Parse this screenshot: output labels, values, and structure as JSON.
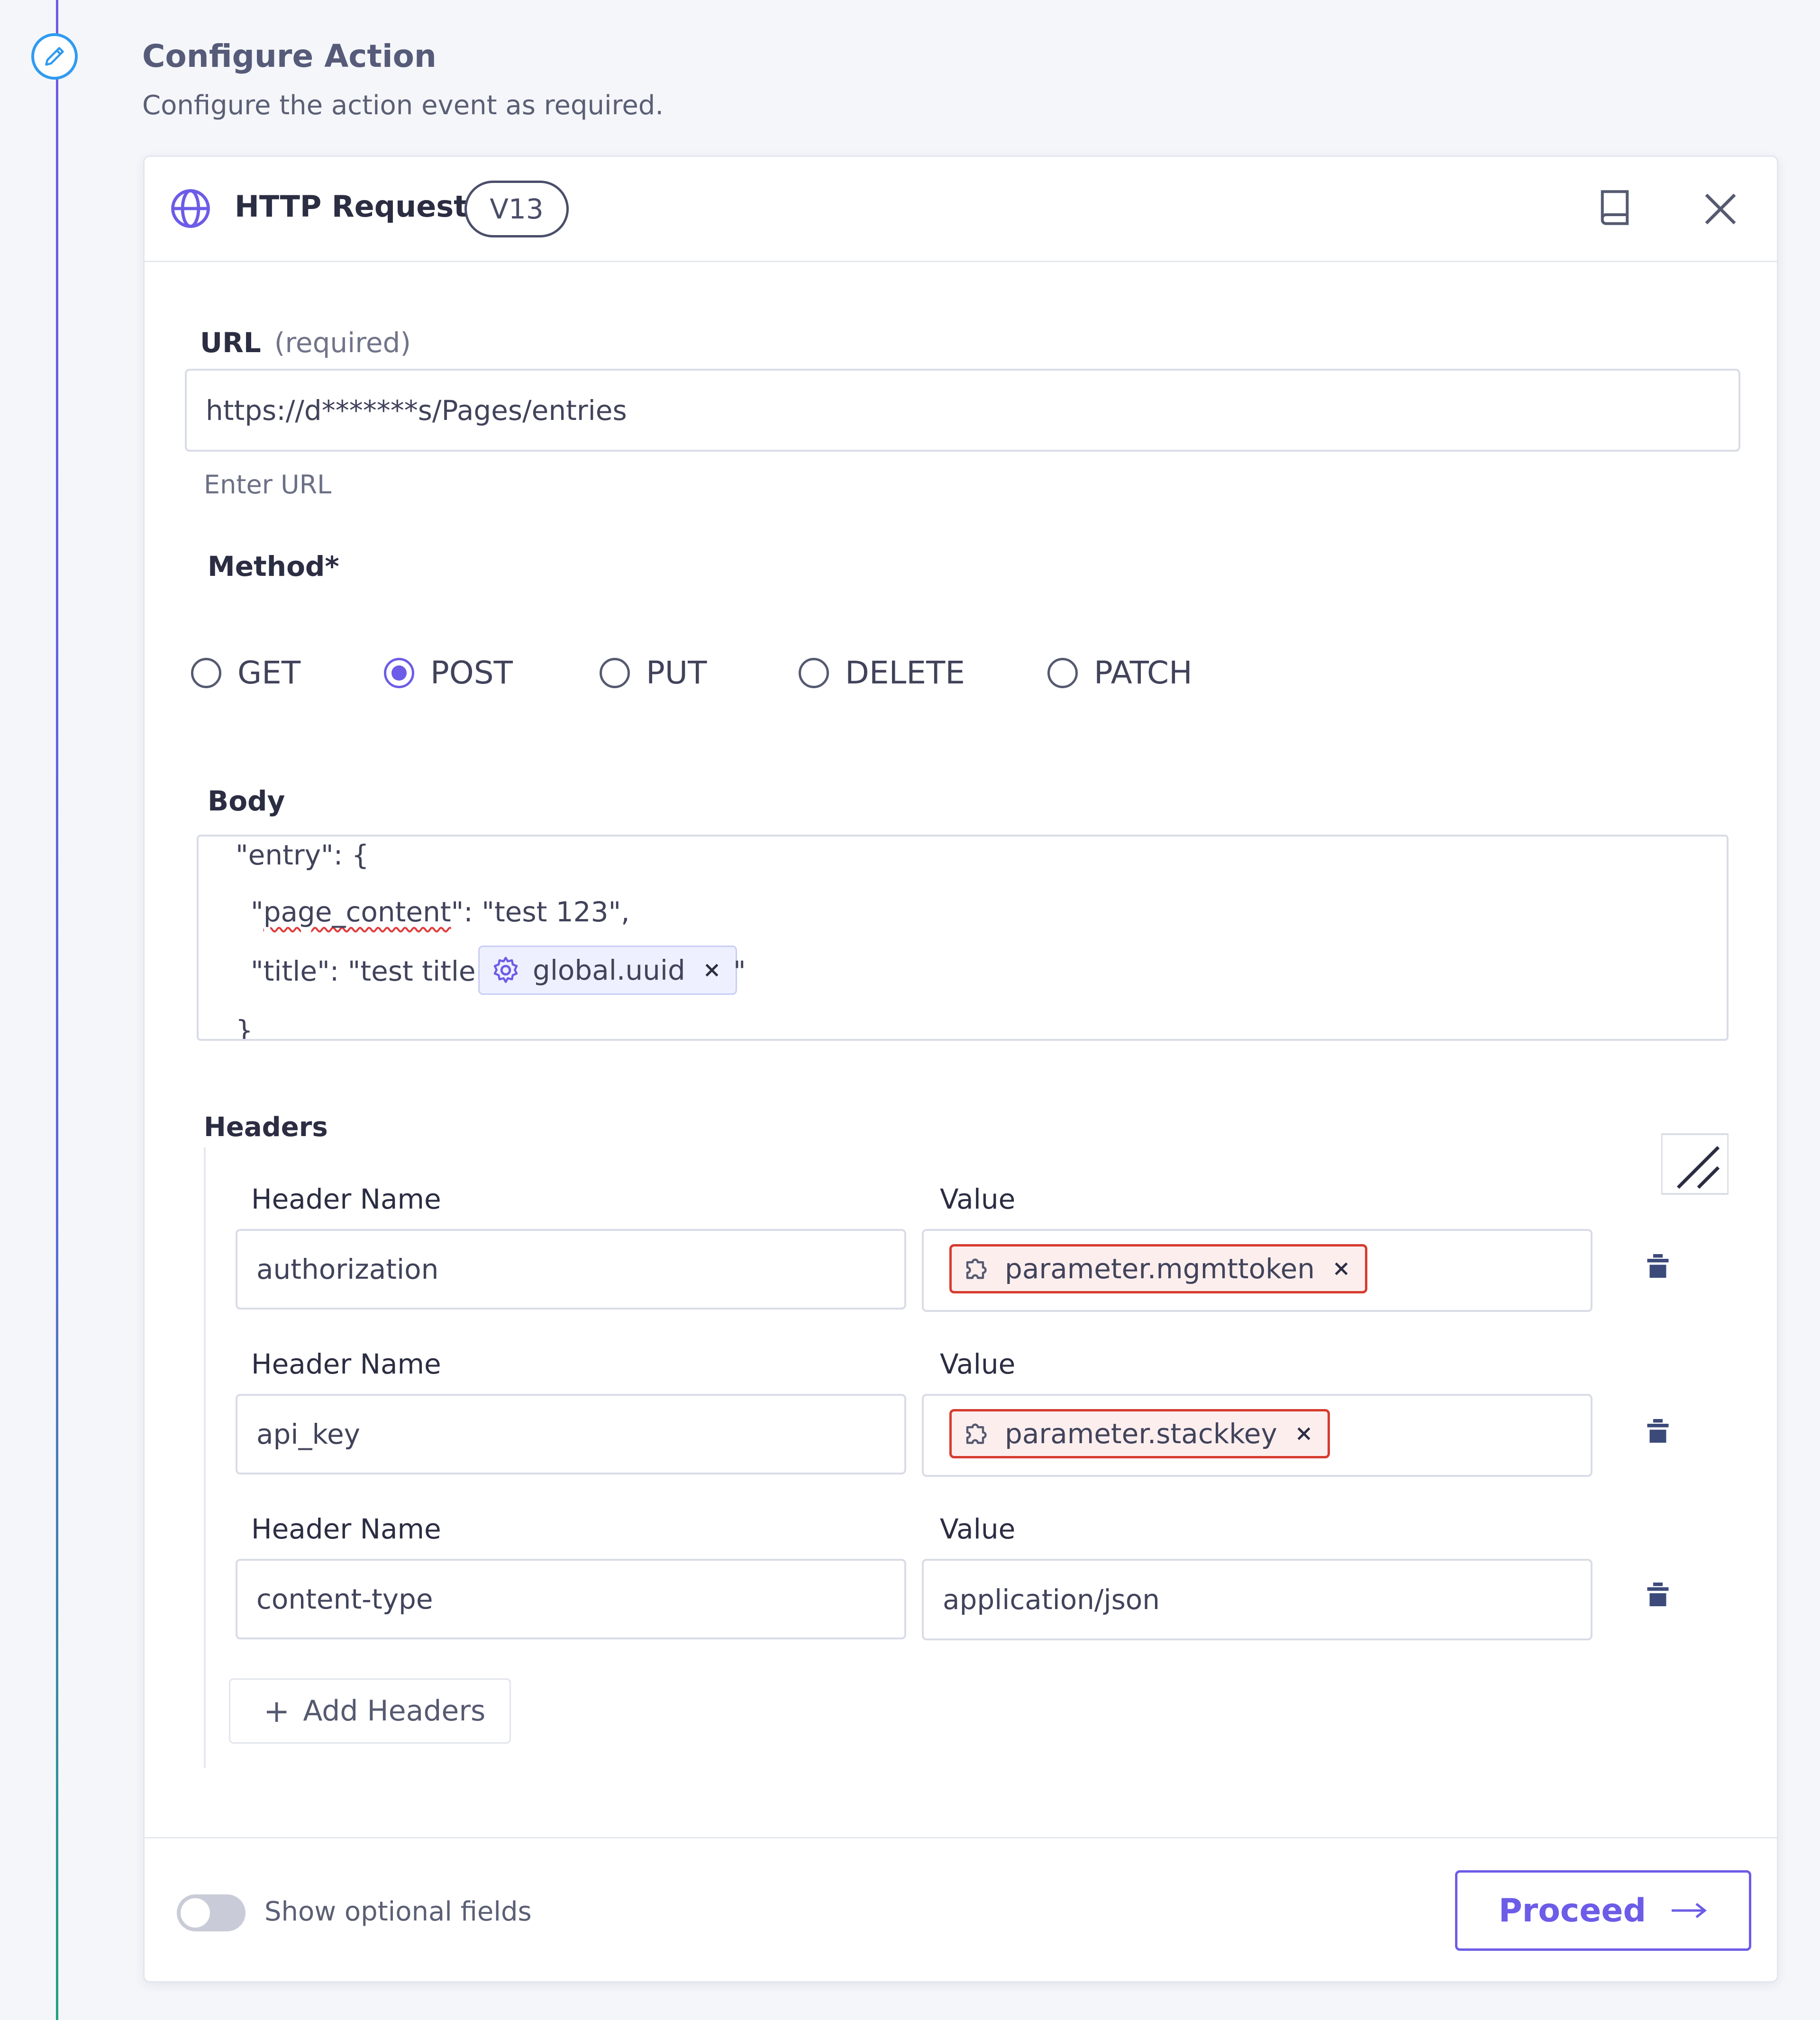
{
  "step": {
    "title": "Configure Action",
    "subtitle": "Configure the action event as required."
  },
  "card": {
    "title": "HTTP Request",
    "version": "V13"
  },
  "url": {
    "label": "URL",
    "required_text": "(required)",
    "value": "https://d*******s/Pages/entries",
    "helper": "Enter URL"
  },
  "method": {
    "label": "Method*",
    "options": [
      "GET",
      "POST",
      "PUT",
      "DELETE",
      "PATCH"
    ],
    "selected": "POST"
  },
  "body": {
    "label": "Body",
    "line1": "\"entry\": {",
    "line2_key": "page_content",
    "line2_rest": "\": \"test 123\",",
    "line2_open": "\"",
    "line3_prefix": "\"title\": \"test title",
    "line3_token": "global.uuid",
    "line3_suffix": "\"",
    "line4": "}"
  },
  "headers": {
    "label": "Headers",
    "name_label": "Header Name",
    "value_label": "Value",
    "rows": [
      {
        "name": "authorization",
        "value_token": "parameter.mgmttoken"
      },
      {
        "name": "api_key",
        "value_token": "parameter.stackkey"
      },
      {
        "name": "content-type",
        "value": "application/json"
      }
    ],
    "add_label": "Add Headers"
  },
  "footer": {
    "toggle_label": "Show optional fields",
    "toggle_on": false,
    "proceed_label": "Proceed"
  },
  "colors": {
    "accent": "#6c5ce7",
    "error": "#d63c2f",
    "timeline_blue": "#2f9bf0"
  }
}
